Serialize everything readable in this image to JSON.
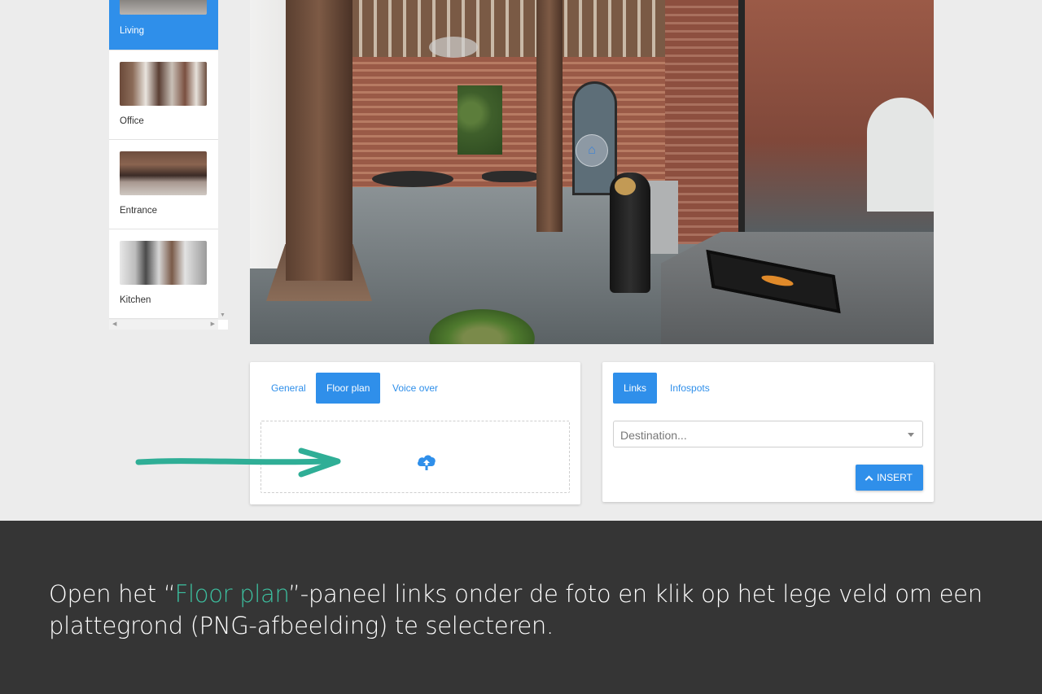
{
  "scenes": {
    "items": [
      {
        "label": "Living",
        "active": true
      },
      {
        "label": "Office",
        "active": false
      },
      {
        "label": "Entrance",
        "active": false
      },
      {
        "label": "Kitchen",
        "active": false
      }
    ]
  },
  "left_panel": {
    "tabs": [
      "General",
      "Floor plan",
      "Voice over"
    ],
    "active_tab": "Floor plan",
    "dropzone_icon": "cloud-upload-icon"
  },
  "right_panel": {
    "tabs": [
      "Links",
      "Infospots"
    ],
    "active_tab": "Links",
    "destination_placeholder": "Destination...",
    "insert_label": "INSERT"
  },
  "caption": {
    "before": "Open het “",
    "highlight": "Floor plan",
    "after": "”-paneel links onder de foto en klik op het lege veld om een plattegrond (PNG-afbeelding) te selecteren."
  },
  "colors": {
    "accent": "#2f8fea",
    "highlight": "#3cc0a0",
    "arrow": "#2fae96",
    "caption_bg": "#353535"
  }
}
